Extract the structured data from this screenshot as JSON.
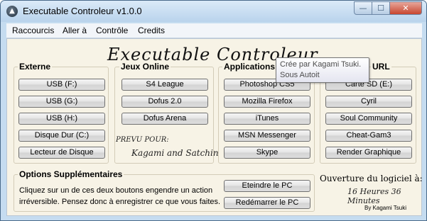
{
  "window": {
    "title": "Executable Controleur v1.0.0"
  },
  "titlebar_buttons": {
    "minimize": "—",
    "maximize": "☐",
    "close": "✕"
  },
  "menu": [
    "Raccourcis",
    "Aller à",
    "Contrôle",
    "Credits"
  ],
  "banner": "Executable Controleur",
  "groups": {
    "externe": {
      "title": "Externe",
      "buttons": [
        "USB (F:)",
        "USB (G:)",
        "USB (H:)",
        "Disque Dur (C:)",
        "Lecteur de Disque"
      ]
    },
    "jeux": {
      "title": "Jeux Online",
      "buttons": [
        "S4 League",
        "Dofus 2.0",
        "Dofus Arena"
      ]
    },
    "applications": {
      "title": "Applications",
      "buttons": [
        "Photoshop CS5",
        "Mozilla Firefox",
        "iTunes",
        "MSN Messenger",
        "Skype"
      ]
    },
    "url": {
      "title": "URL",
      "buttons": [
        "Carte SD (E:)",
        "Cyril",
        "Soul Community",
        "Cheat-Gam3",
        "Render Graphique"
      ]
    }
  },
  "prevu": {
    "label": "PREVU POUR:",
    "names": "Kagami and Satchin"
  },
  "options": {
    "title": "Options Supplémentaires",
    "description_line1": "Cliquez sur un de ces deux boutons engendre un action",
    "description_line2": "irréversible. Pensez donc à enregistrer ce que vous faites.",
    "shutdown": "Eteindre le PC",
    "restart": "Redémarrer le PC"
  },
  "status": {
    "label": "Ouverture du logiciel à:",
    "time": "16 Heures 36 Minutes",
    "author": "By Kagami Tsuki"
  },
  "tooltip": {
    "line1": "Crée par Kagami Tsuki.",
    "line2": "Sous Autoit"
  }
}
